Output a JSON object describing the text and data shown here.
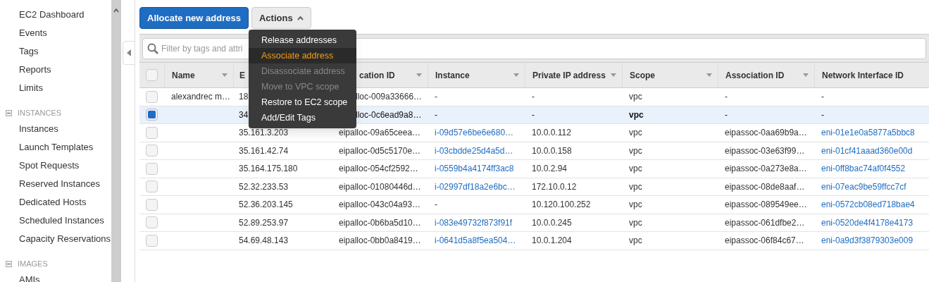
{
  "sidebar": {
    "items": [
      {
        "kind": "link",
        "label": "EC2 Dashboard"
      },
      {
        "kind": "link",
        "label": "Events"
      },
      {
        "kind": "link",
        "label": "Tags"
      },
      {
        "kind": "link",
        "label": "Reports"
      },
      {
        "kind": "link",
        "label": "Limits"
      },
      {
        "kind": "section",
        "label": "INSTANCES",
        "expanded": true
      },
      {
        "kind": "link",
        "label": "Instances"
      },
      {
        "kind": "link",
        "label": "Launch Templates"
      },
      {
        "kind": "link",
        "label": "Spot Requests"
      },
      {
        "kind": "link",
        "label": "Reserved Instances"
      },
      {
        "kind": "link",
        "label": "Dedicated Hosts"
      },
      {
        "kind": "link",
        "label": "Scheduled Instances"
      },
      {
        "kind": "link",
        "label": "Capacity Reservations"
      },
      {
        "kind": "section",
        "label": "IMAGES",
        "expanded": true
      },
      {
        "kind": "link",
        "label": "AMIs"
      }
    ]
  },
  "toolbar": {
    "primary_button": "Allocate new address",
    "actions_button": "Actions",
    "actions_expanded": true
  },
  "actions_menu": [
    {
      "label": "Release addresses",
      "highlighted": false,
      "disabled": false
    },
    {
      "label": "Associate address",
      "highlighted": true,
      "disabled": false
    },
    {
      "label": "Disassociate address",
      "highlighted": false,
      "disabled": true
    },
    {
      "label": "Move to VPC scope",
      "highlighted": false,
      "disabled": true
    },
    {
      "label": "Restore to EC2 scope",
      "highlighted": false,
      "disabled": false
    },
    {
      "label": "Add/Edit Tags",
      "highlighted": false,
      "disabled": false
    }
  ],
  "filter": {
    "placeholder": "Filter by tags and attri"
  },
  "table": {
    "select_all": {
      "checked": false
    },
    "columns": [
      {
        "label": "Name",
        "sortable": true,
        "covered": false
      },
      {
        "label": "E",
        "covered": false
      },
      {
        "label": "cation ID",
        "sortable": true,
        "covered": true
      },
      {
        "label": "Instance",
        "sortable": true,
        "covered": false
      },
      {
        "label": "Private IP address",
        "sortable": true,
        "covered": false
      },
      {
        "label": "Scope",
        "sortable": true,
        "covered": false
      },
      {
        "label": "Association ID",
        "sortable": true,
        "covered": false
      },
      {
        "label": "Network Interface ID",
        "sortable": false,
        "covered": false
      }
    ],
    "rows": [
      {
        "selected": false,
        "cells": [
          "alexandrec m…",
          "18",
          {
            "text": "lloc-009a33666…",
            "covered": true
          },
          "-",
          "-",
          "vpc",
          "-",
          "-"
        ]
      },
      {
        "selected": true,
        "cells": [
          "",
          "34",
          {
            "text": "lloc-0c6ead9a8…",
            "covered": true
          },
          "-",
          "-",
          "vpc",
          "-",
          "-"
        ]
      },
      {
        "selected": false,
        "cells": [
          "",
          "35.161.3.203",
          "eipalloc-09a65ceea…",
          "i-09d57e6be6e680…",
          "10.0.0.112",
          "vpc",
          "eipassoc-0aa69b9a…",
          "eni-01e1e0a5877a5bbc8"
        ]
      },
      {
        "selected": false,
        "cells": [
          "",
          "35.161.42.74",
          "eipalloc-0d5c5170e…",
          "i-03cbdde25d4a5d…",
          "10.0.0.158",
          "vpc",
          "eipassoc-03e63f99…",
          "eni-01cf41aaad360e00d"
        ]
      },
      {
        "selected": false,
        "cells": [
          "",
          "35.164.175.180",
          "eipalloc-054cf2592…",
          "i-0559b4a4174ff3ac8",
          "10.0.2.94",
          "vpc",
          "eipassoc-0a273e8a…",
          "eni-0ff8bac74af0f4552"
        ]
      },
      {
        "selected": false,
        "cells": [
          "",
          "52.32.233.53",
          "eipalloc-01080446d…",
          "i-02997df18a2e6bc…",
          "172.10.0.12",
          "vpc",
          "eipassoc-08de8aaf…",
          "eni-07eac9be59ffcc7cf"
        ]
      },
      {
        "selected": false,
        "cells": [
          "",
          "52.36.203.145",
          "eipalloc-043c04a93…",
          "-",
          "10.120.100.252",
          "vpc",
          "eipassoc-089549ee…",
          "eni-0572cb08ed718bae4"
        ]
      },
      {
        "selected": false,
        "cells": [
          "",
          "52.89.253.97",
          "eipalloc-0b6ba5d10…",
          "i-083e49732f873f91f",
          "10.0.0.245",
          "vpc",
          "eipassoc-061dfbe2…",
          "eni-0520de4f4178e4173"
        ]
      },
      {
        "selected": false,
        "cells": [
          "",
          "54.69.48.143",
          "eipalloc-0bb0a8419…",
          "i-0641d5a8f5ea504…",
          "10.0.1.204",
          "vpc",
          "eipassoc-06f84c67…",
          "eni-0a9d3f3879303e009"
        ]
      }
    ]
  }
}
